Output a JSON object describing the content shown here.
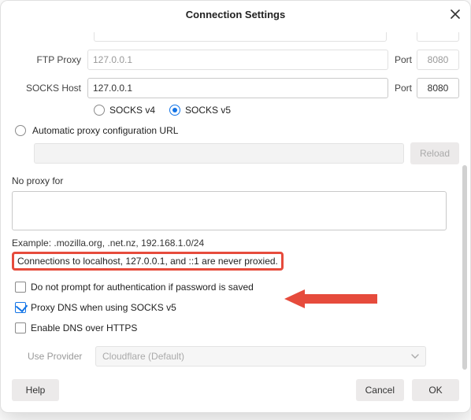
{
  "title": "Connection Settings",
  "ftp": {
    "label": "FTP Proxy",
    "host": "127.0.0.1",
    "port_label": "Port",
    "port": "8080"
  },
  "socks": {
    "label": "SOCKS Host",
    "host": "127.0.0.1",
    "port_label": "Port",
    "port": "8080",
    "v4_label": "SOCKS v4",
    "v5_label": "SOCKS v5"
  },
  "auto_pac_label": "Automatic proxy configuration URL",
  "reload_label": "Reload",
  "no_proxy_label": "No proxy for",
  "no_proxy_value": "",
  "example_text": "Example: .mozilla.org, .net.nz, 192.168.1.0/24",
  "localhost_note": "Connections to localhost, 127.0.0.1, and ::1 are never proxied.",
  "opt_no_prompt": "Do not prompt for authentication if password is saved",
  "opt_proxy_dns": "Proxy DNS when using SOCKS v5",
  "opt_doh": "Enable DNS over HTTPS",
  "provider_label": "Use Provider",
  "provider_value": "Cloudflare (Default)",
  "buttons": {
    "help": "Help",
    "cancel": "Cancel",
    "ok": "OK"
  }
}
